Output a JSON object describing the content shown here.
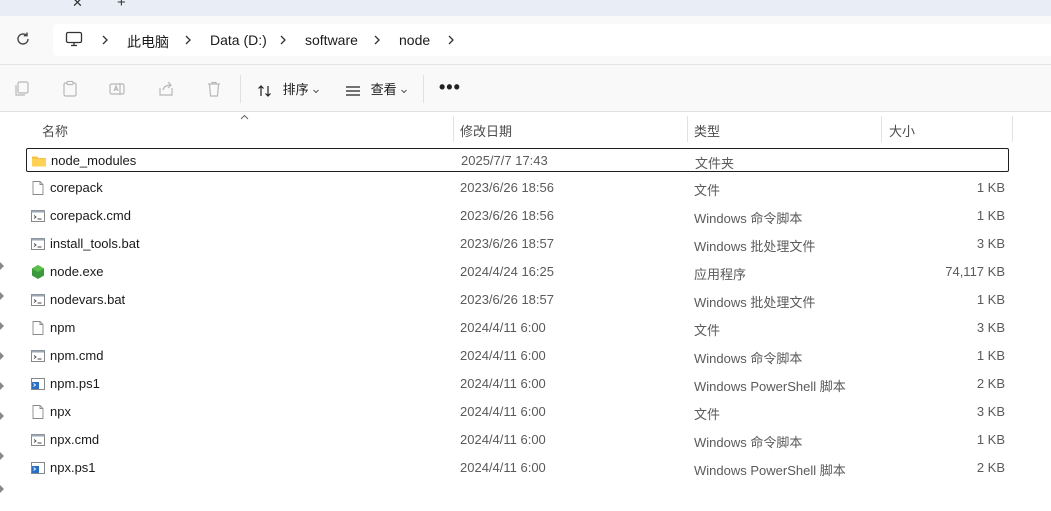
{
  "tabstrip": {
    "close_glyph": "✕",
    "new_glyph": "+"
  },
  "addressbar": {
    "breadcrumbs": [
      "此电脑",
      "Data (D:)",
      "software",
      "node"
    ]
  },
  "toolbar": {
    "sort_label": "排序",
    "view_label": "查看",
    "more_label": "•••"
  },
  "columns": {
    "name": "名称",
    "modified": "修改日期",
    "type": "类型",
    "size": "大小"
  },
  "files": [
    {
      "name": "node_modules",
      "modified": "2025/7/7 17:43",
      "type": "文件夹",
      "size": "",
      "icon": "folder-icon",
      "selected": true
    },
    {
      "name": "corepack",
      "modified": "2023/6/26 18:56",
      "type": "文件",
      "size": "1 KB",
      "icon": "file-icon"
    },
    {
      "name": "corepack.cmd",
      "modified": "2023/6/26 18:56",
      "type": "Windows 命令脚本",
      "size": "1 KB",
      "icon": "script-icon"
    },
    {
      "name": "install_tools.bat",
      "modified": "2023/6/26 18:57",
      "type": "Windows 批处理文件",
      "size": "3 KB",
      "icon": "script-icon"
    },
    {
      "name": "node.exe",
      "modified": "2024/4/24 16:25",
      "type": "应用程序",
      "size": "74,117 KB",
      "icon": "node-exe-icon"
    },
    {
      "name": "nodevars.bat",
      "modified": "2023/6/26 18:57",
      "type": "Windows 批处理文件",
      "size": "1 KB",
      "icon": "script-icon"
    },
    {
      "name": "npm",
      "modified": "2024/4/11 6:00",
      "type": "文件",
      "size": "3 KB",
      "icon": "file-icon"
    },
    {
      "name": "npm.cmd",
      "modified": "2024/4/11 6:00",
      "type": "Windows 命令脚本",
      "size": "1 KB",
      "icon": "script-icon"
    },
    {
      "name": "npm.ps1",
      "modified": "2024/4/11 6:00",
      "type": "Windows PowerShell 脚本",
      "size": "2 KB",
      "icon": "powershell-icon"
    },
    {
      "name": "npx",
      "modified": "2024/4/11 6:00",
      "type": "文件",
      "size": "3 KB",
      "icon": "file-icon"
    },
    {
      "name": "npx.cmd",
      "modified": "2024/4/11 6:00",
      "type": "Windows 命令脚本",
      "size": "1 KB",
      "icon": "script-icon"
    },
    {
      "name": "npx.ps1",
      "modified": "2024/4/11 6:00",
      "type": "Windows PowerShell 脚本",
      "size": "2 KB",
      "icon": "powershell-icon"
    }
  ]
}
